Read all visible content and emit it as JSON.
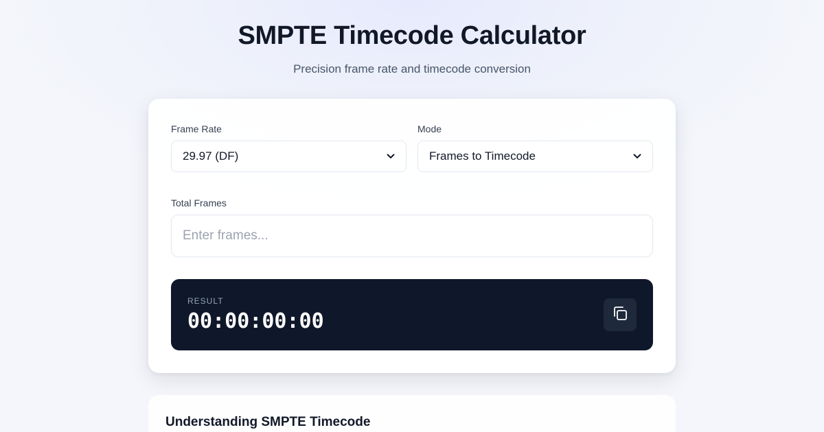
{
  "page": {
    "title": "SMPTE Timecode Calculator",
    "subtitle": "Precision frame rate and timecode conversion"
  },
  "form": {
    "frame_rate": {
      "label": "Frame Rate",
      "selected": "29.97 (DF)"
    },
    "mode": {
      "label": "Mode",
      "selected": "Frames to Timecode"
    },
    "total_frames": {
      "label": "Total Frames",
      "value": "",
      "placeholder": "Enter frames..."
    }
  },
  "result": {
    "label": "RESULT",
    "value": "00:00:00:00",
    "copy_icon": "copy-icon"
  },
  "info": {
    "title": "Understanding SMPTE Timecode"
  },
  "colors": {
    "result_background": "#0f172a",
    "copy_button_background": "#1e293b"
  }
}
